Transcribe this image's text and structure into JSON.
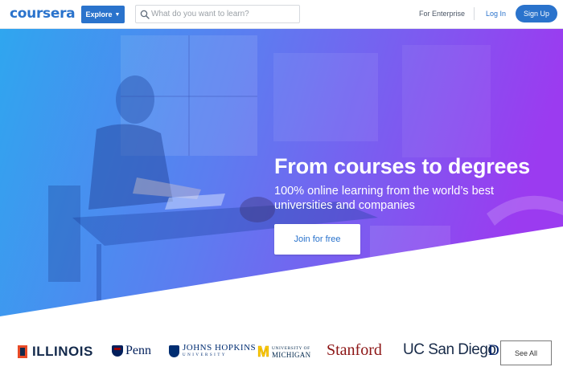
{
  "header": {
    "logo_text": "coursera",
    "explore_label": "Explore",
    "search_placeholder": "What do you want to learn?",
    "enterprise_label": "For Enterprise",
    "login_label": "Log In",
    "signup_label": "Sign Up"
  },
  "hero": {
    "title": "From courses to degrees",
    "subtitle": "100% online learning from the world’s best universities and companies",
    "cta_label": "Join for free"
  },
  "partners": {
    "illinois": "ILLINOIS",
    "penn": "Penn",
    "jhu_line1": "JOHNS HOPKINS",
    "jhu_line2": "UNIVERSITY",
    "michigan_line1": "UNIVERSITY OF",
    "michigan_line2": "MICHIGAN",
    "stanford": "Stanford",
    "ucsd": "UC San Diego",
    "duke": "D",
    "see_all_label": "See All"
  },
  "colors": {
    "brand_blue": "#2a73cc",
    "hero_gradient_start": "#2fa6ef",
    "hero_gradient_end": "#9b3bf0"
  },
  "icons": {
    "search": "search-icon",
    "explore_chevron": "chevron-down-icon"
  }
}
